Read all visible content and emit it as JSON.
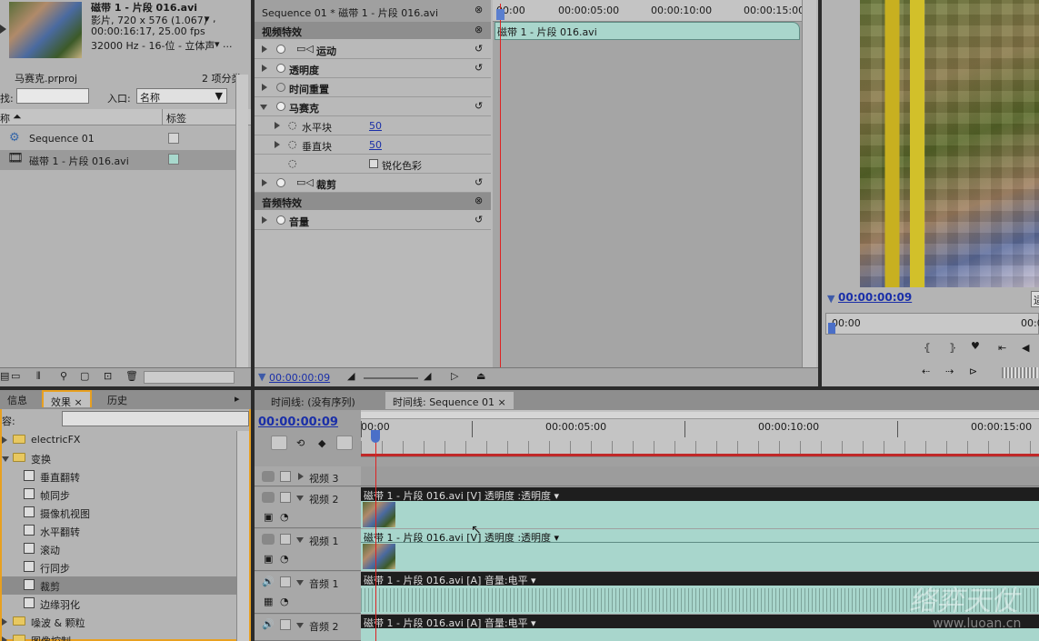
{
  "project": {
    "clip_title": "磁带 1 - 片段 016.avi",
    "clip_info1": "影片, 720 x 576 (1.067)",
    "clip_info1_more": "▾ ,",
    "clip_info2": "00:00:16:17, 25.00 fps",
    "clip_info3": "32000 Hz - 16-位 - 立体声",
    "clip_info3_more": "▾ ...",
    "project_name": "马赛克.prproj",
    "item_count": "2 项分类",
    "find_label": "找:",
    "entry_label": "入口:",
    "entry_value": "名称",
    "col_name": "称",
    "col_label": "标签",
    "items": [
      {
        "name": "Sequence 01",
        "color": "#d0d0d0"
      },
      {
        "name": "磁带 1 - 片段 016.avi",
        "color": "#a8d8cc"
      }
    ]
  },
  "effect_controls": {
    "title": "Sequence 01 * 磁带 1 - 片段 016.avi",
    "video_fx_header": "视频特效",
    "audio_fx_header": "音频特效",
    "effects": [
      {
        "name": "运动"
      },
      {
        "name": "透明度"
      },
      {
        "name": "时间重置"
      },
      {
        "name": "马赛克"
      },
      {
        "name": "水平块",
        "value": "50"
      },
      {
        "name": "垂直块",
        "value": "50"
      },
      {
        "name": "锐化色彩"
      },
      {
        "name": "裁剪"
      },
      {
        "name": "音量"
      }
    ],
    "ruler": [
      "00:00",
      "00:00:05:00",
      "00:00:10:00",
      "00:00:15:00"
    ],
    "clip_label": "磁带 1 - 片段 016.avi",
    "timecode": "00:00:00:09"
  },
  "monitor": {
    "timecode": "00:00:00:09",
    "ruler_start": "00:00",
    "ruler_end": "00:0",
    "btn_label": "适"
  },
  "effects_panel": {
    "tabs": [
      "信息",
      "效果",
      "历史"
    ],
    "close": "×",
    "find_label": "容:",
    "tree": [
      {
        "name": "electricFX",
        "type": "folder"
      },
      {
        "name": "变换",
        "type": "folder-open"
      },
      {
        "name": "垂直翻转",
        "type": "fx"
      },
      {
        "name": "帧同步",
        "type": "fx"
      },
      {
        "name": "摄像机视图",
        "type": "fx"
      },
      {
        "name": "水平翻转",
        "type": "fx"
      },
      {
        "name": "滚动",
        "type": "fx"
      },
      {
        "name": "行同步",
        "type": "fx"
      },
      {
        "name": "裁剪",
        "type": "fx",
        "selected": true
      },
      {
        "name": "边缘羽化",
        "type": "fx"
      },
      {
        "name": "噪波 & 颗粒",
        "type": "folder"
      },
      {
        "name": "图像控制",
        "type": "folder"
      }
    ]
  },
  "timeline": {
    "tabs": [
      "时间线: (没有序列)",
      "时间线: Sequence 01"
    ],
    "close": "×",
    "timecode": "00:00:00:09",
    "ruler": [
      "00:00",
      "00:00:05:00",
      "00:00:10:00",
      "00:00:15:00"
    ],
    "tracks": [
      {
        "name": "视频 3"
      },
      {
        "name": "视频 2",
        "clip": "磁带 1 - 片段 016.avi [V]",
        "fx": "透明度 :透明度 ▾"
      },
      {
        "name": "视频 1",
        "clip": "磁带 1 - 片段 016.avi [V]",
        "fx": "透明度 :透明度 ▾"
      },
      {
        "name": "音频 1",
        "clip": "磁带 1 - 片段 016.avi [A]",
        "fx": "音量:电平 ▾"
      },
      {
        "name": "音频 2",
        "clip": "磁带 1 - 片段 016.avi [A]",
        "fx": "音量:电平 ▾"
      }
    ]
  },
  "watermark": {
    "text1": "络弈天仗",
    "text2": "www.luoan.cn"
  }
}
